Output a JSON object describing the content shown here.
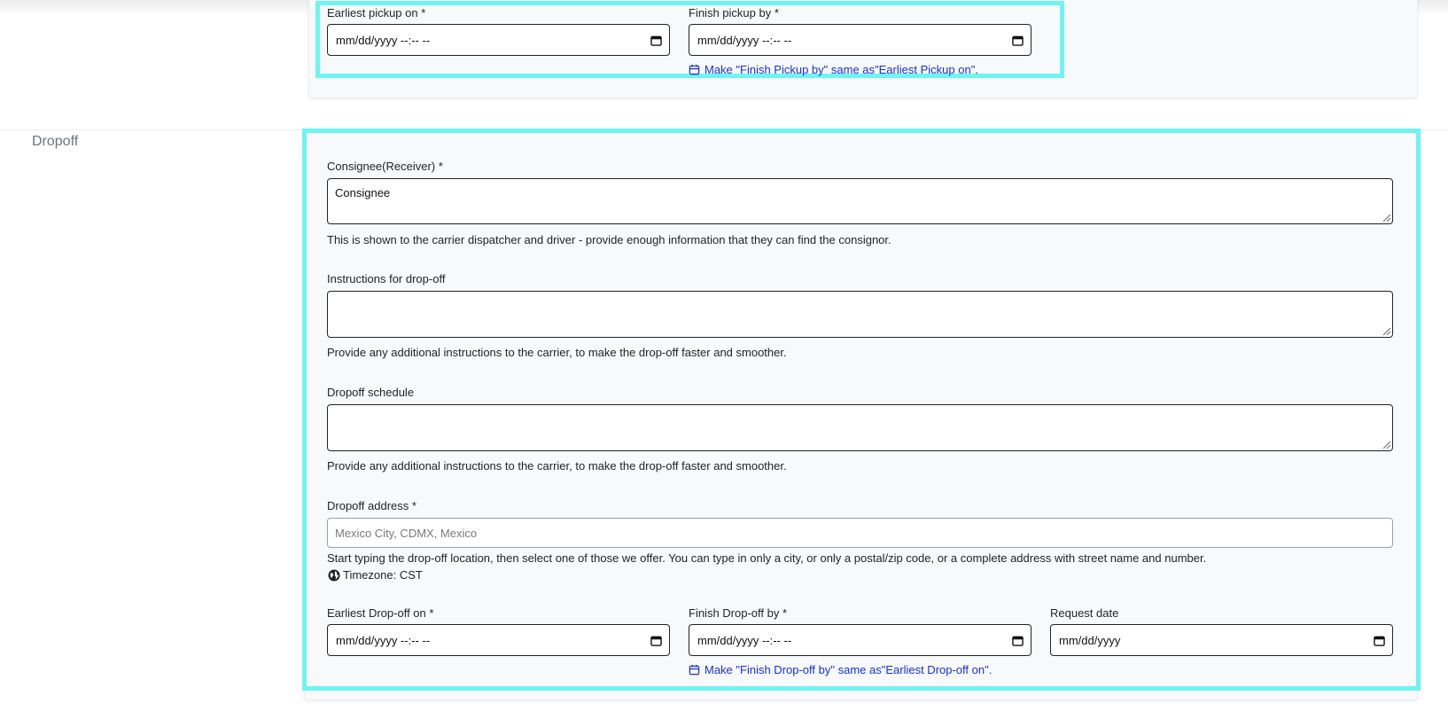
{
  "pickup": {
    "earliest_label": "Earliest pickup on *",
    "earliest_value": "mm/dd/yyyy --:-- --",
    "finish_label": "Finish pickup by *",
    "finish_value": "mm/dd/yyyy --:-- --",
    "same_link": "Make \"Finish Pickup by\" same as\"Earliest Pickup on\"."
  },
  "dropoff": {
    "section_title": "Dropoff",
    "consignee_label": "Consignee(Receiver) *",
    "consignee_value": "Consignee",
    "consignee_help": "This is shown to the carrier dispatcher and driver - provide enough information that they can find the consignor.",
    "instructions_label": "Instructions for drop-off",
    "instructions_value": "",
    "instructions_help": "Provide any additional instructions to the carrier, to make the drop-off faster and smoother.",
    "schedule_label": "Dropoff schedule",
    "schedule_value": "",
    "schedule_help": "Provide any additional instructions to the carrier, to make the drop-off faster and smoother.",
    "address_label": "Dropoff address *",
    "address_placeholder": "Mexico City, CDMX, Mexico",
    "address_help": "Start typing the drop-off location, then select one of those we offer. You can type in only a city, or only a postal/zip code, or a complete address with street name and number.",
    "timezone": "Timezone: CST",
    "earliest_label": "Earliest Drop-off on *",
    "earliest_value": "mm/dd/yyyy --:-- --",
    "finish_label": "Finish Drop-off by *",
    "finish_value": "mm/dd/yyyy --:-- --",
    "request_label": "Request date",
    "request_value": "mm/dd/yyyy",
    "same_link": "Make \"Finish Drop-off by\" same as\"Earliest Drop-off on\"."
  },
  "colors": {
    "highlight": "#6ff3f3",
    "link": "#1a2fdc",
    "card_bg": "#f8f9fa"
  },
  "icons": [
    "calendar-icon",
    "globe-icon"
  ]
}
